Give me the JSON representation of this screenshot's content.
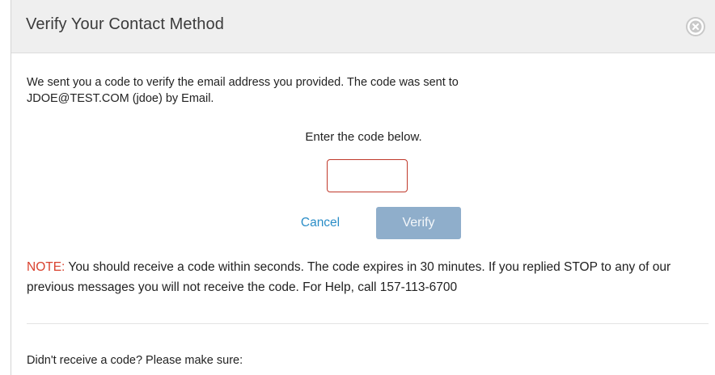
{
  "dialog": {
    "title": "Verify Your Contact Method",
    "close_icon": "close-circle-icon"
  },
  "message": {
    "line1": "We sent you a code to verify the email address you provided. The code was sent to",
    "line2": "JDOE@TEST.COM (jdoe) by Email."
  },
  "code_entry": {
    "prompt": "Enter the code below.",
    "input_value": "",
    "input_border_color": "#c0392b"
  },
  "actions": {
    "cancel_label": "Cancel",
    "verify_label": "Verify",
    "verify_color": "#8faecb",
    "link_color": "#2a8dc7"
  },
  "note": {
    "label": "NOTE:",
    "text": " You should receive a code within seconds. The code expires in 30 minutes. If you replied STOP to any of our previous messages you will not receive the code. For Help, call 157-113-6700",
    "label_color": "#d9412e"
  },
  "help": {
    "heading": "Didn't receive a code? Please make sure:"
  }
}
